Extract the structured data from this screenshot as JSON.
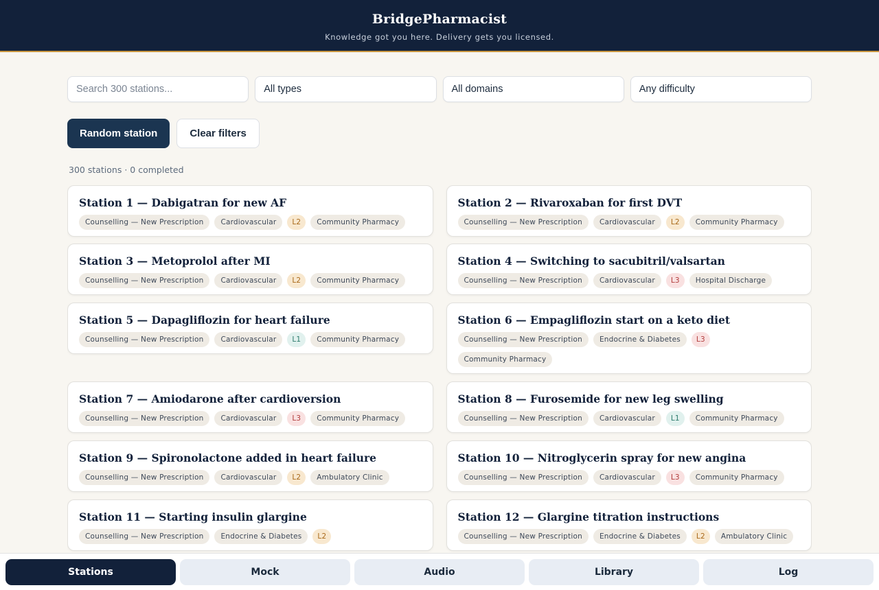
{
  "header": {
    "title": "BridgePharmacist",
    "subtitle": "Knowledge got you here. Delivery gets you licensed."
  },
  "filters": {
    "search_placeholder": "Search 300 stations...",
    "type": "All types",
    "domain": "All domains",
    "difficulty": "Any difficulty"
  },
  "actions": {
    "random_label": "Random station",
    "clear_label": "Clear filters"
  },
  "status": "300 stations · 0 completed",
  "stations": [
    {
      "title": "Station 1 — Dabigatran for new AF",
      "type": "Counselling — New Prescription",
      "domain": "Cardiovascular",
      "level": "L2",
      "setting": "Community Pharmacy"
    },
    {
      "title": "Station 2 — Rivaroxaban for first DVT",
      "type": "Counselling — New Prescription",
      "domain": "Cardiovascular",
      "level": "L2",
      "setting": "Community Pharmacy"
    },
    {
      "title": "Station 3 — Metoprolol after MI",
      "type": "Counselling — New Prescription",
      "domain": "Cardiovascular",
      "level": "L2",
      "setting": "Community Pharmacy"
    },
    {
      "title": "Station 4 — Switching to sacubitril/valsartan",
      "type": "Counselling — New Prescription",
      "domain": "Cardiovascular",
      "level": "L3",
      "setting": "Hospital Discharge"
    },
    {
      "title": "Station 5 — Dapagliflozin for heart failure",
      "type": "Counselling — New Prescription",
      "domain": "Cardiovascular",
      "level": "L1",
      "setting": "Community Pharmacy"
    },
    {
      "title": "Station 6 — Empagliflozin start on a keto diet",
      "type": "Counselling — New Prescription",
      "domain": "Endocrine & Diabetes",
      "level": "L3",
      "setting": "Community Pharmacy"
    },
    {
      "title": "Station 7 — Amiodarone after cardioversion",
      "type": "Counselling — New Prescription",
      "domain": "Cardiovascular",
      "level": "L3",
      "setting": "Community Pharmacy"
    },
    {
      "title": "Station 8 — Furosemide for new leg swelling",
      "type": "Counselling — New Prescription",
      "domain": "Cardiovascular",
      "level": "L1",
      "setting": "Community Pharmacy"
    },
    {
      "title": "Station 9 — Spironolactone added in heart failure",
      "type": "Counselling — New Prescription",
      "domain": "Cardiovascular",
      "level": "L2",
      "setting": "Ambulatory Clinic"
    },
    {
      "title": "Station 10 — Nitroglycerin spray for new angina",
      "type": "Counselling — New Prescription",
      "domain": "Cardiovascular",
      "level": "L3",
      "setting": "Community Pharmacy"
    },
    {
      "title": "Station 11 — Starting insulin glargine",
      "type": "Counselling — New Prescription",
      "domain": "Endocrine & Diabetes",
      "level": "L2",
      "setting": ""
    },
    {
      "title": "Station 12 — Glargine titration instructions",
      "type": "Counselling — New Prescription",
      "domain": "Endocrine & Diabetes",
      "level": "L2",
      "setting": "Ambulatory Clinic"
    }
  ],
  "tabs": [
    {
      "label": "Stations",
      "active": true
    },
    {
      "label": "Mock",
      "active": false
    },
    {
      "label": "Audio",
      "active": false
    },
    {
      "label": "Library",
      "active": false
    },
    {
      "label": "Log",
      "active": false
    }
  ]
}
